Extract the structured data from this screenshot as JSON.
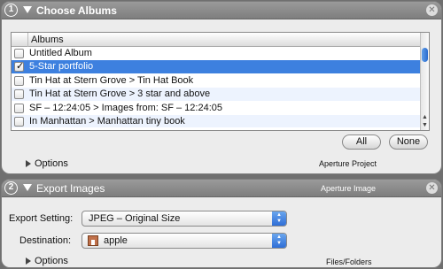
{
  "step1": {
    "number": "1",
    "title": "Choose Albums",
    "table": {
      "column_header": "Albums",
      "rows": [
        {
          "label": "Untitled Album",
          "checked": false,
          "selected": false
        },
        {
          "label": "5-Star portfolio",
          "checked": true,
          "selected": true
        },
        {
          "label": "Tin Hat at Stern Grove > Tin Hat Book",
          "checked": false,
          "selected": false
        },
        {
          "label": "Tin Hat at Stern Grove > 3 star and above",
          "checked": false,
          "selected": false
        },
        {
          "label": "SF – 12:24:05 >  Images from: SF – 12:24:05",
          "checked": false,
          "selected": false
        },
        {
          "label": "In Manhattan > Manhattan tiny book",
          "checked": false,
          "selected": false
        }
      ]
    },
    "all_label": "All",
    "none_label": "None",
    "options_label": "Options",
    "footer_hint": "Aperture Project"
  },
  "step2": {
    "number": "2",
    "title": "Export Images",
    "header_hint": "Aperture Image",
    "export_setting_label": "Export Setting:",
    "export_setting_value": "JPEG – Original Size",
    "destination_label": "Destination:",
    "destination_value": "apple",
    "options_label": "Options",
    "footer_hint": "Files/Folders"
  },
  "colors": {
    "selection": "#3d80df",
    "header": "#8a8a8a",
    "popup_arrows": "#2f6ed6"
  },
  "icons": {
    "close": "close-icon",
    "disclosure": "disclosure-triangle-icon",
    "home": "home-folder-icon"
  }
}
